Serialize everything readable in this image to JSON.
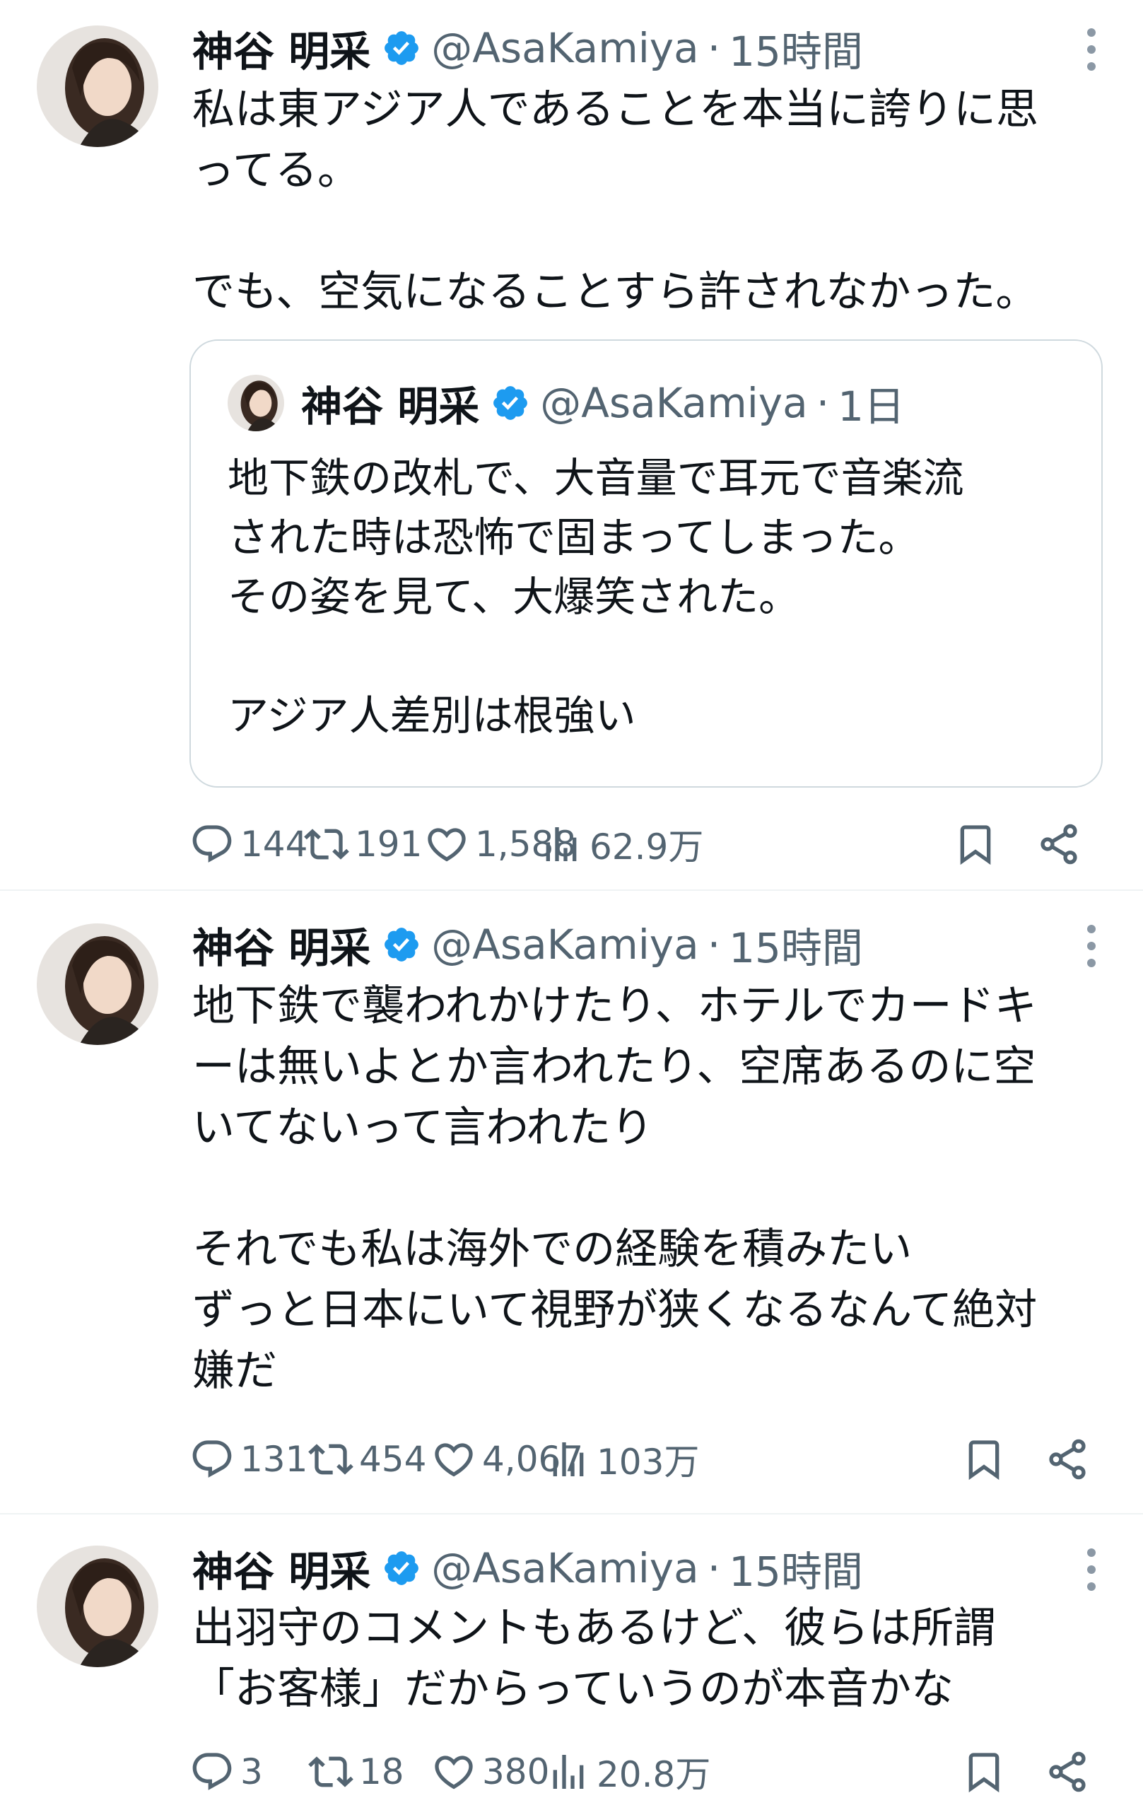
{
  "tweets": [
    {
      "display_name": "神谷 明采",
      "handle": "@AsaKamiya",
      "separator": "·",
      "time": "15時間",
      "text": "私は東アジア人であることを本当に誇りに思\nってる。\n\nでも、空気になることすら許されなかった。",
      "quote": {
        "display_name": "神谷 明采",
        "handle": "@AsaKamiya",
        "separator": "·",
        "time": "1日",
        "text": "地下鉄の改札で、大音量で耳元で音楽流\nされた時は恐怖で固まってしまった。\nその姿を見て、大爆笑された。\n\nアジア人差別は根強い"
      },
      "replies": "144",
      "reposts": "191",
      "likes": "1,588",
      "views": "62.9万"
    },
    {
      "display_name": "神谷 明采",
      "handle": "@AsaKamiya",
      "separator": "·",
      "time": "15時間",
      "text": "地下鉄で襲われかけたり、ホテルでカードキ\nーは無いよとか言われたり、空席あるのに空\nいてないって言われたり\n\nそれでも私は海外での経験を積みたい\nずっと日本にいて視野が狭くなるなんて絶対\n嫌だ",
      "replies": "131",
      "reposts": "454",
      "likes": "4,067",
      "views": "103万"
    },
    {
      "display_name": "神谷 明采",
      "handle": "@AsaKamiya",
      "separator": "·",
      "time": "15時間",
      "text": "出羽守のコメントもあるけど、彼らは所謂\n「お客様」だからっていうのが本音かな",
      "replies": "3",
      "reposts": "18",
      "likes": "380",
      "views": "20.8万"
    }
  ],
  "colors": {
    "verified": "#1d9bf0",
    "secondary_text": "#536471",
    "border": "#cfd9de",
    "divider": "#eff3f4"
  },
  "icons": [
    "avatar-photo",
    "verified-badge-icon",
    "more-icon",
    "reply-icon",
    "repost-icon",
    "like-icon",
    "views-icon",
    "bookmark-icon",
    "share-icon"
  ]
}
